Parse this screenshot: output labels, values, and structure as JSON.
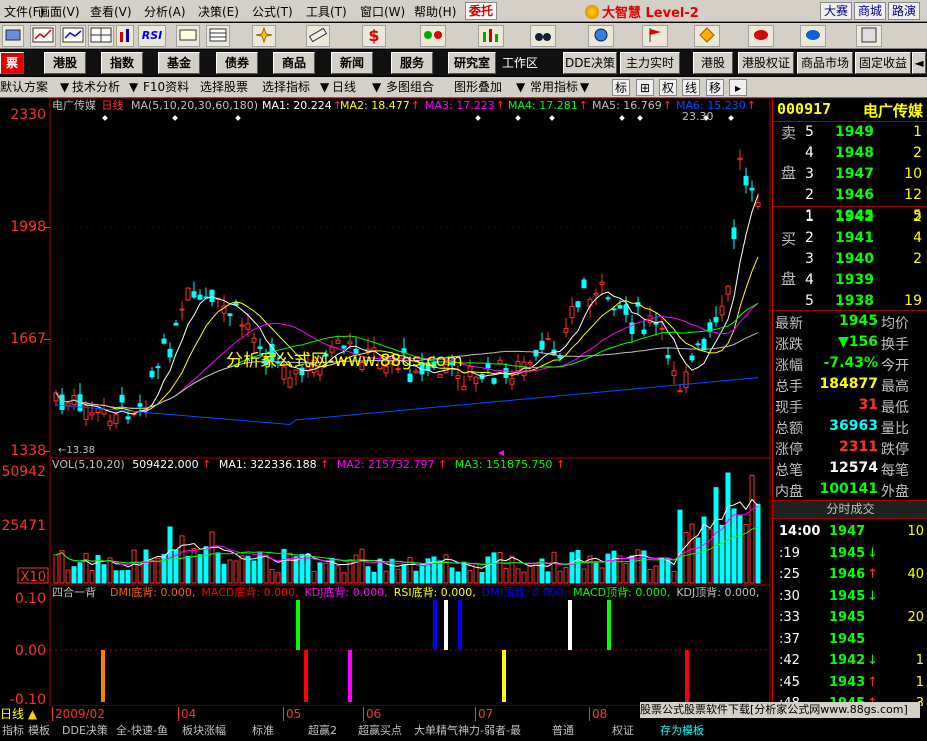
{
  "menu": {
    "items": [
      "文件(F)",
      "画面(V)",
      "查看(V)",
      "分析(A)",
      "决策(E)",
      "公式(T)",
      "工具(T)",
      "窗口(W)",
      "帮助(H)"
    ],
    "entrust": "委托",
    "brand": "大智慧 Level-2",
    "right_buttons": [
      "大赛",
      "商城",
      "路演"
    ]
  },
  "iconbar": {
    "items": [
      "RSI",
      "$"
    ]
  },
  "nav": {
    "items": [
      "票",
      "港股",
      "指数",
      "基金",
      "债券",
      "商品",
      "新闻",
      "服务",
      "研究室",
      "工作区",
      "DDE决策",
      "主力实时出",
      "港股",
      "港股权证",
      "商品市场",
      "固定收益"
    ]
  },
  "toolbar": {
    "items": [
      "默认方案",
      "技术分析",
      "F10资料",
      "选择股票",
      "选择指标",
      "日线",
      "多图组合",
      "图形叠加",
      "常用指标",
      "标",
      "权",
      "线",
      "移",
      "▸"
    ]
  },
  "main_chart": {
    "stock_name": "电广传媒",
    "period": "日线",
    "ma_label": "MA(5,10,20,30,60,180)",
    "ma_values": [
      {
        "label": "MA1: 20.224",
        "color": "#ffffff"
      },
      {
        "label": "MA2: 18.477",
        "color": "#ffff00"
      },
      {
        "label": "MA3: 17.223",
        "color": "#ff00ff"
      },
      {
        "label": "MA4: 17.281",
        "color": "#00ff00"
      },
      {
        "label": "MA5: 16.769",
        "color": "#c0c0c0"
      },
      {
        "label": "MA6: 15.230",
        "color": "#0050ff"
      }
    ],
    "y_ticks": [
      "2330",
      "1998",
      "1667",
      "1338"
    ],
    "high_label": "23.30",
    "low_label": "←13.38",
    "watermark": "分析家公式网-www.88gs.com"
  },
  "volume": {
    "label": "VOL(5,10,20)",
    "value": "509422.000",
    "ma1": "MA1: 322336.188",
    "ma2": "MA2: 215732.797",
    "ma3": "MA3: 151875.750",
    "y_ticks": [
      "50942",
      "25471",
      "X10"
    ]
  },
  "indicator": {
    "title": "四合一背",
    "items": [
      {
        "label": "DMI底背: 0.000,",
        "color": "#ff6000"
      },
      {
        "label": "MACD底背: 0.000,",
        "color": "#ff0000"
      },
      {
        "label": "KDJ底背: 0.000,",
        "color": "#ff00ff"
      },
      {
        "label": "RSI底背: 0.000,",
        "color": "#ffff00"
      },
      {
        "label": "DMI顶背: 0.000,",
        "color": "#0000ff"
      },
      {
        "label": "MACD顶背: 0.000,",
        "color": "#00ff00"
      },
      {
        "label": "KDJ顶背: 0.000,",
        "color": "#c0c0c0"
      }
    ],
    "y_ticks": [
      "0.10",
      "0.00",
      "-0.10"
    ]
  },
  "date_axis": [
    "2009/02",
    "04",
    "05",
    "06",
    "07",
    "08"
  ],
  "quote": {
    "code": "000917",
    "name": "电广传媒",
    "sell_label": [
      "卖",
      "盘"
    ],
    "buy_label": [
      "买",
      "盘"
    ],
    "asks": [
      {
        "level": "5",
        "price": "1949",
        "vol": "1"
      },
      {
        "level": "4",
        "price": "1948",
        "vol": "2"
      },
      {
        "level": "3",
        "price": "1947",
        "vol": "10"
      },
      {
        "level": "2",
        "price": "1946",
        "vol": "12"
      },
      {
        "level": "1",
        "price": "1945",
        "vol": "5"
      }
    ],
    "bids": [
      {
        "level": "1",
        "price": "1942",
        "vol": "2"
      },
      {
        "level": "2",
        "price": "1941",
        "vol": "4"
      },
      {
        "level": "3",
        "price": "1940",
        "vol": "2"
      },
      {
        "level": "4",
        "price": "1939",
        "vol": ""
      },
      {
        "level": "5",
        "price": "1938",
        "vol": "19"
      }
    ],
    "stats": [
      {
        "label": "最新",
        "value": "1945",
        "label2": "均价",
        "color": "#00ff00"
      },
      {
        "label": "涨跌",
        "value": "▼156",
        "label2": "换手",
        "color": "#00ff00"
      },
      {
        "label": "涨幅",
        "value": "-7.43%",
        "label2": "今开",
        "color": "#00ff00"
      },
      {
        "label": "总手",
        "value": "184877",
        "label2": "最高",
        "color": "#ffff00"
      },
      {
        "label": "现手",
        "value": "31",
        "label2": "最低",
        "color": "#ff3030"
      },
      {
        "label": "总额",
        "value": "36963",
        "label2": "量比",
        "color": "#00ffff"
      },
      {
        "label": "涨停",
        "value": "2311",
        "label2": "跌停",
        "color": "#ff3030"
      },
      {
        "label": "总笔",
        "value": "12574",
        "label2": "每笔",
        "color": "#ffffff"
      },
      {
        "label": "内盘",
        "value": "100141",
        "label2": "外盘",
        "color": "#00ff00"
      }
    ],
    "ticks_title": "分时成交",
    "ticks": [
      {
        "time": "14:00",
        "price": "1947",
        "vol": "10",
        "arrow": ""
      },
      {
        "time": ":19",
        "price": "1945",
        "vol": "",
        "arrow": "↓"
      },
      {
        "time": ":25",
        "price": "1946",
        "vol": "40",
        "arrow": "↑"
      },
      {
        "time": ":30",
        "price": "1945",
        "vol": "",
        "arrow": "↓"
      },
      {
        "time": ":33",
        "price": "1945",
        "vol": "20",
        "arrow": ""
      },
      {
        "time": ":37",
        "price": "1945",
        "vol": "",
        "arrow": ""
      },
      {
        "time": ":42",
        "price": "1942",
        "vol": "1",
        "arrow": "↓"
      },
      {
        "time": ":45",
        "price": "1943",
        "vol": "1",
        "arrow": "↑"
      },
      {
        "time": ":48",
        "price": "1945",
        "vol": "3",
        "arrow": "↑"
      }
    ]
  },
  "bottom": {
    "left_label": "日线",
    "tabs": [
      "指标",
      "模板",
      "DDE决策",
      "全-快速-鱼",
      "板块涨幅",
      "标准",
      "超赢2",
      "超赢买点",
      "大单精气神力-弱者-最",
      "普通",
      "权证",
      "存为模板"
    ],
    "ad": "股票公式股票软件下载[分析家公式网www.88gs.com]"
  }
}
